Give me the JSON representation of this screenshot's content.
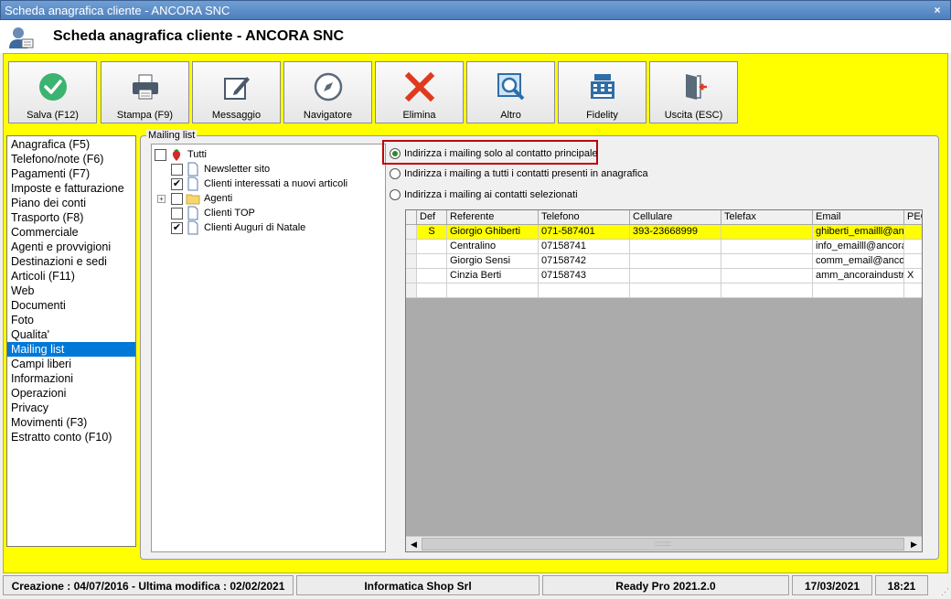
{
  "window": {
    "title": "Scheda anagrafica cliente - ANCORA SNC",
    "close_symbol": "×"
  },
  "header": {
    "title": "Scheda anagrafica cliente - ANCORA SNC",
    "icon": "user-card-icon"
  },
  "toolbar": {
    "buttons": [
      {
        "label": "Salva (F12)",
        "icon": "check-circle-icon"
      },
      {
        "label": "Stampa (F9)",
        "icon": "printer-icon"
      },
      {
        "label": "Messaggio",
        "icon": "pencil-note-icon"
      },
      {
        "label": "Navigatore",
        "icon": "compass-icon"
      },
      {
        "label": "Elimina",
        "icon": "red-x-icon"
      },
      {
        "label": "Altro",
        "icon": "magnifier-icon"
      },
      {
        "label": "Fidelity",
        "icon": "cash-register-icon"
      },
      {
        "label": "Uscita (ESC)",
        "icon": "exit-door-icon"
      }
    ]
  },
  "nav": {
    "items": [
      "Anagrafica (F5)",
      "Telefono/note (F6)",
      "Pagamenti (F7)",
      "Imposte e fatturazione",
      "Piano dei conti",
      "Trasporto (F8)",
      "Commerciale",
      "Agenti e provvigioni",
      "Destinazioni e sedi",
      "Articoli (F11)",
      "Web",
      "Documenti",
      "Foto",
      "Qualita'",
      "Mailing list",
      "Campi liberi",
      "Informazioni",
      "Operazioni",
      "Privacy",
      "Movimenti (F3)",
      "Estratto conto (F10)"
    ],
    "selected": "Mailing list"
  },
  "mailing": {
    "group_label": "Mailing list",
    "tree": {
      "root": {
        "label": "Tutti",
        "checked": false
      },
      "children": [
        {
          "label": "Newsletter sito",
          "checked": false,
          "type": "doc"
        },
        {
          "label": "Clienti interessati a nuovi articoli",
          "checked": true,
          "type": "doc"
        },
        {
          "label": "Agenti",
          "checked": false,
          "type": "folder",
          "expand": "+"
        },
        {
          "label": "Clienti TOP",
          "checked": false,
          "type": "doc"
        },
        {
          "label": "Clienti Auguri di Natale",
          "checked": true,
          "type": "doc"
        }
      ]
    },
    "radio_options": [
      {
        "label": "Indirizza i mailing solo al contatto principale",
        "selected": true
      },
      {
        "label": "Indirizza i mailing a tutti i contatti presenti in anagrafica",
        "selected": false
      },
      {
        "label": "Indirizza i mailing ai contatti selezionati",
        "selected": false
      }
    ],
    "grid": {
      "columns": [
        "Def",
        "Referente",
        "Telefono",
        "Cellulare",
        "Telefax",
        "Email",
        "PEC"
      ],
      "rows": [
        {
          "def": "S",
          "referente": "Giorgio Ghiberti",
          "telefono": "071-587401",
          "cellulare": "393-23668999",
          "telefax": "",
          "email": "ghiberti_emailll@an",
          "pec": "",
          "selected": true
        },
        {
          "def": "",
          "referente": "Centralino",
          "telefono": "07158741",
          "cellulare": "",
          "telefax": "",
          "email": "info_emailll@ancora",
          "pec": "",
          "selected": false
        },
        {
          "def": "",
          "referente": "Giorgio Sensi",
          "telefono": "07158742",
          "cellulare": "",
          "telefax": "",
          "email": "comm_email@ancor",
          "pec": "",
          "selected": false
        },
        {
          "def": "",
          "referente": "Cinzia Berti",
          "telefono": "07158743",
          "cellulare": "",
          "telefax": "",
          "email": "amm_ancoraindustr",
          "pec": "X",
          "selected": false
        }
      ]
    },
    "scroll": {
      "left": "◀",
      "right": "▶",
      "grip": "::::::::"
    }
  },
  "status": {
    "creation": "Creazione : 04/07/2016 - Ultima modifica : 02/02/2021",
    "company": "Informatica Shop Srl",
    "version": "Ready Pro 2021.2.0",
    "date": "17/03/2021",
    "time": "18:21",
    "grip": "⋰"
  }
}
